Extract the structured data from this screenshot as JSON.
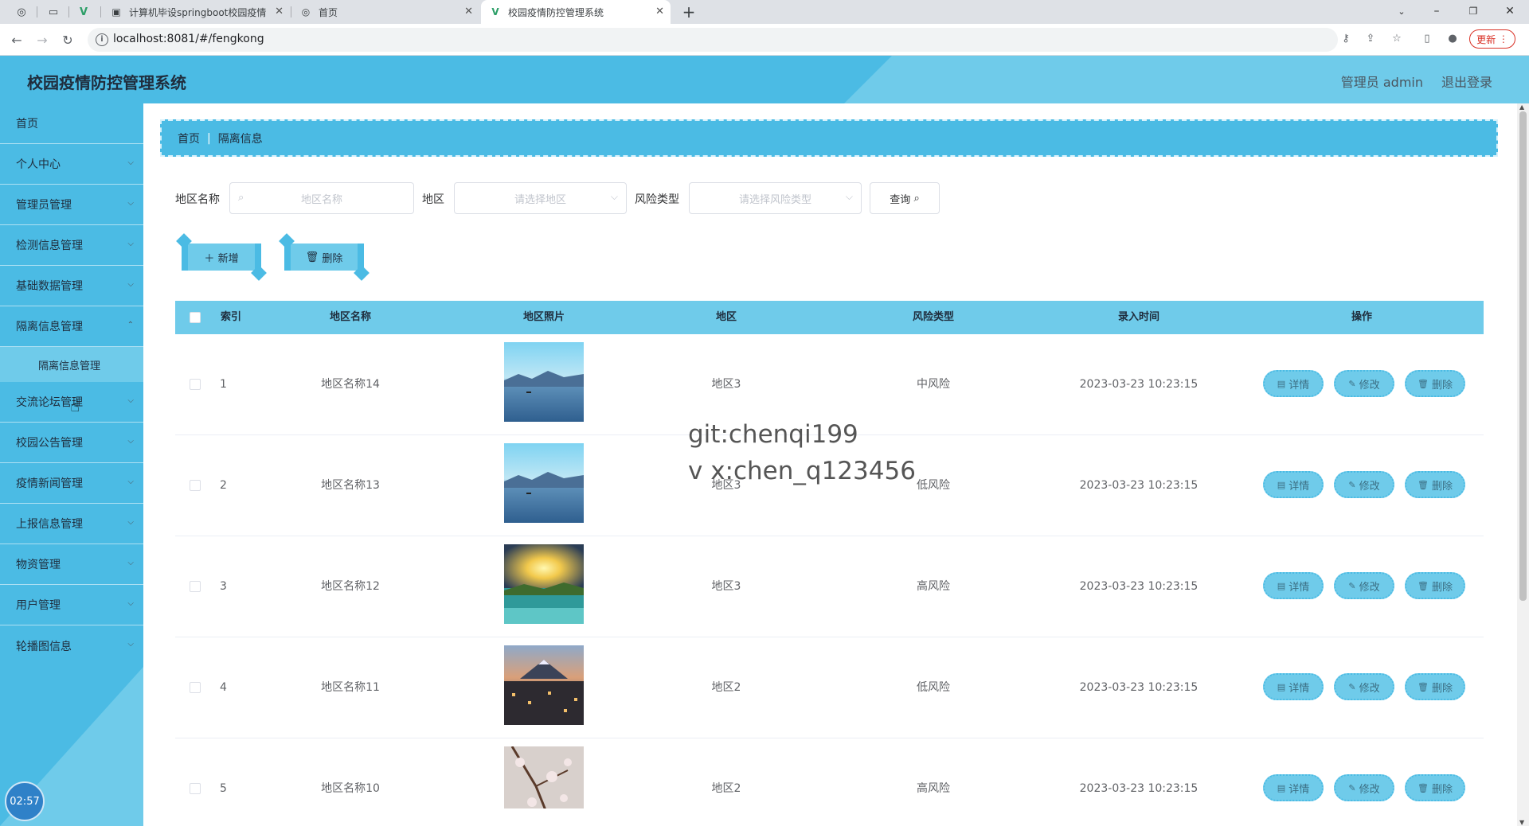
{
  "browser": {
    "tabs": [
      {
        "title": "计算机毕设springboot校园疫情"
      },
      {
        "title": "首页"
      },
      {
        "title": "校园疫情防控管理系统"
      }
    ],
    "url": "localhost:8081/#/fengkong",
    "update_label": "更新"
  },
  "header": {
    "title": "校园疫情防控管理系统",
    "user": "管理员 admin",
    "logout": "退出登录"
  },
  "sidebar": {
    "items": [
      {
        "label": "首页"
      },
      {
        "label": "个人中心"
      },
      {
        "label": "管理员管理"
      },
      {
        "label": "检测信息管理"
      },
      {
        "label": "基础数据管理"
      },
      {
        "label": "隔离信息管理"
      },
      {
        "label": "交流论坛管理"
      },
      {
        "label": "校园公告管理"
      },
      {
        "label": "疫情新闻管理"
      },
      {
        "label": "上报信息管理"
      },
      {
        "label": "物资管理"
      },
      {
        "label": "用户管理"
      },
      {
        "label": "轮播图信息"
      }
    ],
    "submenu": {
      "label": "隔离信息管理"
    },
    "timer": "02:57"
  },
  "breadcrumb": {
    "home": "首页",
    "current": "隔离信息"
  },
  "search": {
    "name_label": "地区名称",
    "name_placeholder": "地区名称",
    "region_label": "地区",
    "region_placeholder": "请选择地区",
    "risk_label": "风险类型",
    "risk_placeholder": "请选择风险类型",
    "query_label": "查询"
  },
  "actions": {
    "add": "新增",
    "delete": "删除"
  },
  "table": {
    "headers": [
      "索引",
      "地区名称",
      "地区照片",
      "地区",
      "风险类型",
      "录入时间",
      "操作"
    ],
    "rows": [
      {
        "index": "1",
        "name": "地区名称14",
        "region": "地区3",
        "risk": "中风险",
        "time": "2023-03-23 10:23:15",
        "photo": "lake"
      },
      {
        "index": "2",
        "name": "地区名称13",
        "region": "地区3",
        "risk": "低风险",
        "time": "2023-03-23 10:23:15",
        "photo": "lake"
      },
      {
        "index": "3",
        "name": "地区名称12",
        "region": "地区3",
        "risk": "高风险",
        "time": "2023-03-23 10:23:15",
        "photo": "sunset"
      },
      {
        "index": "4",
        "name": "地区名称11",
        "region": "地区2",
        "risk": "低风险",
        "time": "2023-03-23 10:23:15",
        "photo": "city"
      },
      {
        "index": "5",
        "name": "地区名称10",
        "region": "地区2",
        "risk": "高风险",
        "time": "2023-03-23 10:23:15",
        "photo": "blossom"
      }
    ],
    "row_actions": {
      "detail": "详情",
      "edit": "修改",
      "delete": "删除"
    }
  },
  "watermark": {
    "line1": "git:chenqi199",
    "line2": "v x:chen_q123456"
  }
}
